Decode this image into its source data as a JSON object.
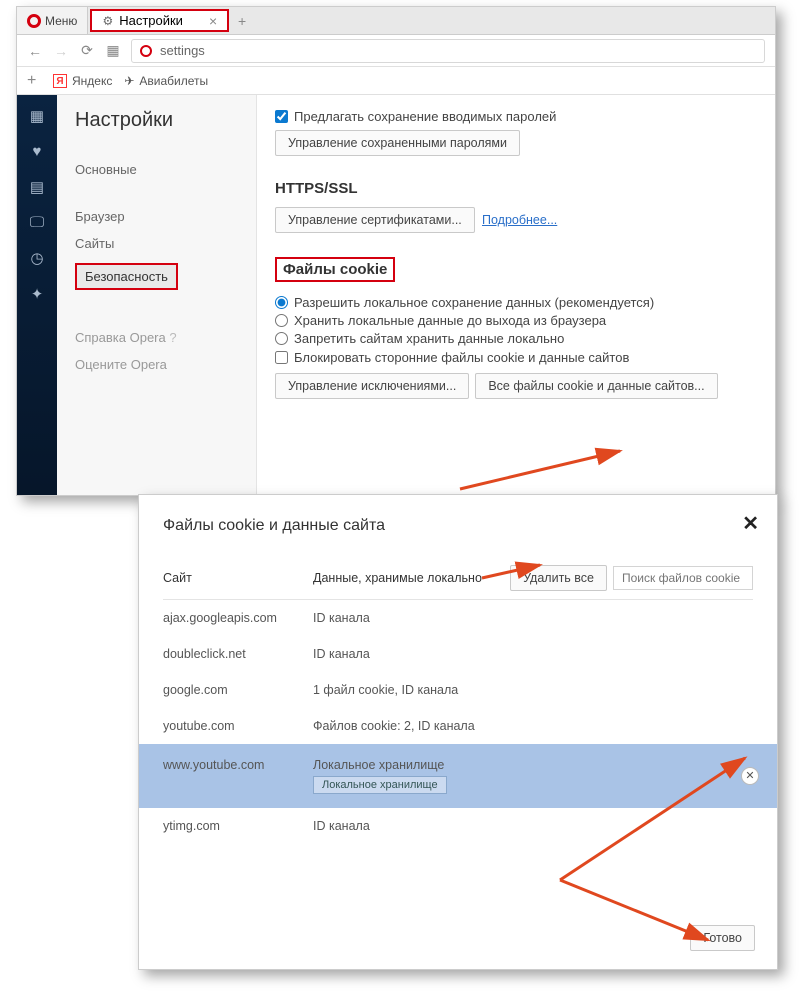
{
  "browser": {
    "menu_label": "Меню",
    "tab_title": "Настройки",
    "url_text": "settings",
    "bookmarks": {
      "yandex": "Яндекс",
      "avia": "Авиабилеты"
    }
  },
  "sidebar": {
    "title": "Настройки",
    "items": [
      "Основные",
      "Браузер",
      "Сайты",
      "Безопасность"
    ],
    "help": "Справка Opera",
    "rate": "Оцените Opera"
  },
  "content": {
    "pw_save": "Предлагать сохранение вводимых паролей",
    "pw_manage_btn": "Управление сохраненными паролями",
    "https_heading": "HTTPS/SSL",
    "cert_btn": "Управление сертификатами...",
    "more_link": "Подробнее...",
    "cookie_heading": "Файлы cookie",
    "radio1": "Разрешить локальное сохранение данных (рекомендуется)",
    "radio2": "Хранить локальные данные до выхода из браузера",
    "radio3": "Запретить сайтам хранить данные локально",
    "block3p": "Блокировать сторонние файлы cookie и данные сайтов",
    "exceptions_btn": "Управление исключениями...",
    "all_cookies_btn": "Все файлы cookie и данные сайтов..."
  },
  "dialog": {
    "title": "Файлы cookie и данные сайта",
    "col_site": "Сайт",
    "col_data": "Данные, хранимые локально",
    "delete_all_btn": "Удалить все",
    "search_placeholder": "Поиск файлов cookie",
    "rows": [
      {
        "site": "ajax.googleapis.com",
        "data": "ID канала"
      },
      {
        "site": "doubleclick.net",
        "data": "ID канала"
      },
      {
        "site": "google.com",
        "data": "1 файл cookie, ID канала"
      },
      {
        "site": "youtube.com",
        "data": "Файлов cookie: 2, ID канала"
      },
      {
        "site": "www.youtube.com",
        "data": "Локальное хранилище",
        "chip": "Локальное хранилище"
      },
      {
        "site": "ytimg.com",
        "data": "ID канала"
      }
    ],
    "done_btn": "Готово"
  }
}
